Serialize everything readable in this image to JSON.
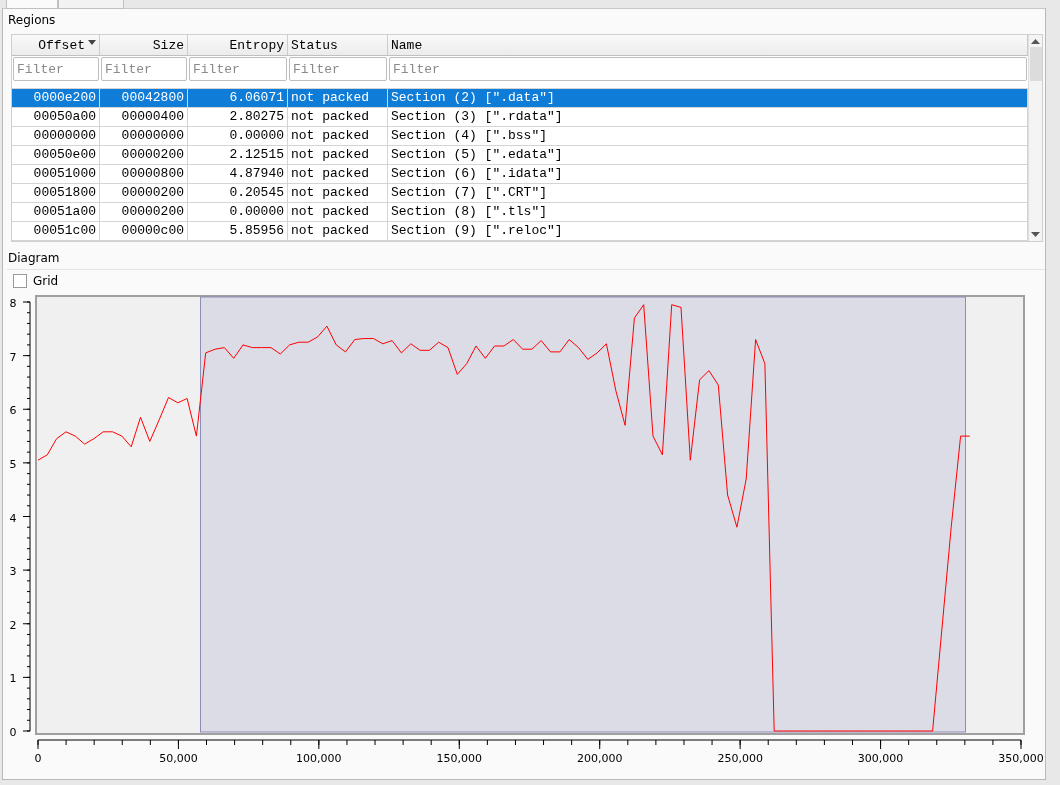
{
  "regions": {
    "title": "Regions",
    "columns": [
      {
        "label": "Offset",
        "sorted": true
      },
      {
        "label": "Size",
        "sorted": false
      },
      {
        "label": "Entropy",
        "sorted": false
      },
      {
        "label": "Status",
        "sorted": false
      },
      {
        "label": "Name",
        "sorted": false
      }
    ],
    "filters": [
      {
        "placeholder": "Filter"
      },
      {
        "placeholder": "Filter"
      },
      {
        "placeholder": "Filter"
      },
      {
        "placeholder": "Filter"
      },
      {
        "placeholder": "Filter"
      }
    ],
    "rows": [
      {
        "cells": [
          "0000e200",
          "00042800",
          "6.06071",
          "not packed",
          "Section (2) [\".data\"]"
        ],
        "selected": true
      },
      {
        "cells": [
          "00050a00",
          "00000400",
          "2.80275",
          "not packed",
          "Section (3) [\".rdata\"]"
        ],
        "selected": false
      },
      {
        "cells": [
          "00000000",
          "00000000",
          "0.00000",
          "not packed",
          "Section (4) [\".bss\"]"
        ],
        "selected": false
      },
      {
        "cells": [
          "00050e00",
          "00000200",
          "2.12515",
          "not packed",
          "Section (5) [\".edata\"]"
        ],
        "selected": false
      },
      {
        "cells": [
          "00051000",
          "00000800",
          "4.87940",
          "not packed",
          "Section (6) [\".idata\"]"
        ],
        "selected": false
      },
      {
        "cells": [
          "00051800",
          "00000200",
          "0.20545",
          "not packed",
          "Section (7) [\".CRT\"]"
        ],
        "selected": false
      },
      {
        "cells": [
          "00051a00",
          "00000200",
          "0.00000",
          "not packed",
          "Section (8) [\".tls\"]"
        ],
        "selected": false
      },
      {
        "cells": [
          "00051c00",
          "00000c00",
          "5.85956",
          "not packed",
          "Section (9) [\".reloc\"]"
        ],
        "selected": false
      }
    ]
  },
  "diagram": {
    "title": "Diagram",
    "grid": {
      "label": "Grid",
      "checked": false
    },
    "chart_data": {
      "type": "line",
      "xlim": [
        0,
        350000
      ],
      "ylim": [
        0,
        8
      ],
      "xticks": [
        {
          "value": 0,
          "label": "0"
        },
        {
          "value": 50000,
          "label": "50,000"
        },
        {
          "value": 100000,
          "label": "100,000"
        },
        {
          "value": 150000,
          "label": "150,000"
        },
        {
          "value": 200000,
          "label": "200,000"
        },
        {
          "value": 250000,
          "label": "250,000"
        },
        {
          "value": 300000,
          "label": "300,000"
        },
        {
          "value": 350000,
          "label": "350,000"
        }
      ],
      "yticks": [
        0,
        1,
        2,
        3,
        4,
        5,
        6,
        7,
        8
      ],
      "bands": [
        {
          "axis": "x",
          "from": 57856,
          "to": 330240,
          "color": "#dcdce6"
        }
      ],
      "x": [
        0,
        3318,
        6636,
        9954,
        13272,
        16590,
        19908,
        23226,
        26544,
        29862,
        33180,
        36498,
        39816,
        43134,
        46452,
        49770,
        53088,
        56406,
        59724,
        63042,
        66360,
        69678,
        72996,
        76314,
        79632,
        82950,
        86268,
        89586,
        92904,
        96222,
        99540,
        102858,
        106176,
        109494,
        112812,
        116130,
        119448,
        122766,
        126084,
        129402,
        132720,
        136038,
        139356,
        142674,
        145992,
        149310,
        152628,
        155946,
        159264,
        162582,
        165900,
        169218,
        172536,
        175854,
        179172,
        182490,
        185808,
        189126,
        192444,
        195762,
        199080,
        202398,
        205716,
        209034,
        212352,
        215670,
        218988,
        222306,
        225624,
        228942,
        232260,
        235578,
        238896,
        242214,
        245532,
        248850,
        252168,
        255486,
        258804,
        262122,
        265440,
        268758,
        272076,
        275394,
        278712,
        282030,
        285348,
        288666,
        291984,
        295302,
        298620,
        301938,
        305256,
        308574,
        311892,
        315210,
        318528,
        321846,
        325164,
        328482,
        331800
      ],
      "series": [
        {
          "color": "#ff0000",
          "values": [
            5.05,
            5.15,
            5.45,
            5.58,
            5.5,
            5.35,
            5.45,
            5.58,
            5.58,
            5.5,
            5.3,
            5.85,
            5.4,
            5.8,
            6.22,
            6.12,
            6.2,
            5.5,
            7.05,
            7.12,
            7.15,
            6.95,
            7.2,
            7.15,
            7.15,
            7.15,
            7.03,
            7.2,
            7.25,
            7.25,
            7.35,
            7.55,
            7.2,
            7.07,
            7.3,
            7.32,
            7.32,
            7.22,
            7.28,
            7.05,
            7.22,
            7.1,
            7.1,
            7.25,
            7.15,
            6.65,
            6.85,
            7.18,
            6.95,
            7.18,
            7.18,
            7.3,
            7.12,
            7.12,
            7.28,
            7.07,
            7.07,
            7.3,
            7.15,
            6.93,
            7.05,
            7.22,
            6.35,
            5.7,
            7.7,
            7.95,
            5.5,
            5.15,
            7.95,
            7.9,
            5.05,
            6.55,
            6.72,
            6.45,
            4.4,
            3.8,
            4.7,
            7.3,
            6.85,
            0,
            0,
            0,
            0,
            0,
            0,
            0,
            0,
            0,
            0,
            0,
            0,
            0,
            0,
            0,
            0,
            0,
            0,
            1.9,
            3.8,
            5.5,
            5.5
          ]
        }
      ]
    }
  }
}
